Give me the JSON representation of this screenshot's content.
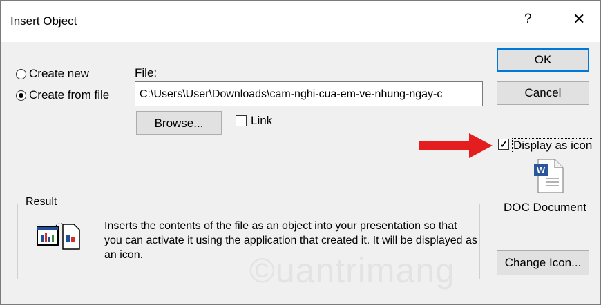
{
  "window": {
    "title": "Insert Object",
    "help_label": "?",
    "close_label": "✕"
  },
  "options": {
    "create_new_label": "Create new",
    "create_from_file_label": "Create from file",
    "selected": "create_from_file"
  },
  "file": {
    "label": "File:",
    "value": "C:\\Users\\User\\Downloads\\cam-nghi-cua-em-ve-nhung-ngay-c",
    "browse_label": "Browse...",
    "link_label": "Link",
    "link_checked": false
  },
  "buttons": {
    "ok_label": "OK",
    "cancel_label": "Cancel",
    "change_icon_label": "Change Icon..."
  },
  "display_as_icon": {
    "label": "Display as icon",
    "checked": true,
    "icon_name": "word-document-icon",
    "icon_caption": "DOC Document"
  },
  "result": {
    "legend": "Result",
    "icon_name": "embedded-object-icon",
    "text": "Inserts the contents of the file as an object into your presentation so that you can activate it using the application that created it. It will be displayed as an icon."
  },
  "annotation": {
    "arrow_color": "#e41e1e",
    "watermark_icon": "quantrimang-watermark"
  },
  "colors": {
    "dialog_bg": "#f0f0f0",
    "accent": "#0078d7",
    "word_blue": "#2b579a"
  }
}
